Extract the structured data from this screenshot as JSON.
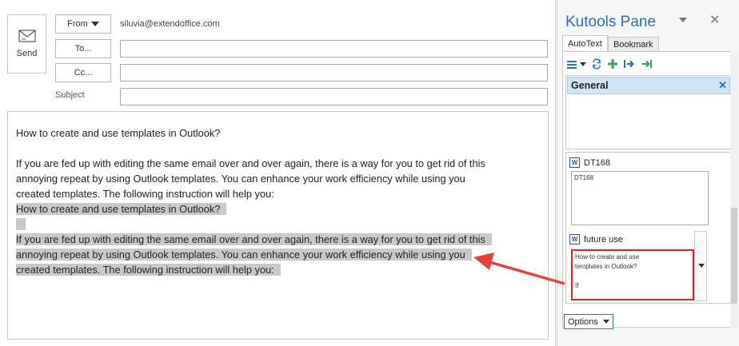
{
  "compose": {
    "send_label": "Send",
    "from_label": "From",
    "from_address": "siluvia@extendoffice.com",
    "to_label": "To...",
    "cc_label": "Cc...",
    "subject_label": "Subject",
    "body": {
      "line1": "How to create and use templates in Outlook?",
      "para1_l1": "If you are fed up with editing the same email over and over again, there is a way for you to get rid of this",
      "para1_l2": "annoying repeat by using Outlook templates. You can enhance your work efficiency while using you",
      "para1_l3": "created templates. The following instruction will help you:",
      "hl_line1": "How to create and use templates in Outlook?",
      "hl_para_l1": "If you are fed up with editing the same email over and over again, there is a way for you to get rid of this",
      "hl_para_l2": "annoying repeat by using Outlook templates. You can enhance your work efficiency while using you",
      "hl_para_l3": "created templates. The following instruction will help you:"
    }
  },
  "pane": {
    "title": "Kutools Pane",
    "tabs": [
      {
        "label": "AutoText"
      },
      {
        "label": "Bookmark"
      }
    ],
    "group": "General",
    "entries": [
      {
        "name": "DT168",
        "preview": "DT168"
      },
      {
        "name": "future use",
        "preview_l1": "How to create and use",
        "preview_l2": "templates in Outlook?",
        "preview_l3": "If"
      }
    ],
    "options_label": "Options",
    "icon_w": "W"
  },
  "colors": {
    "accent": "#2f6fb4",
    "highlight": "#c9c9c9",
    "annotation": "#e02020"
  }
}
